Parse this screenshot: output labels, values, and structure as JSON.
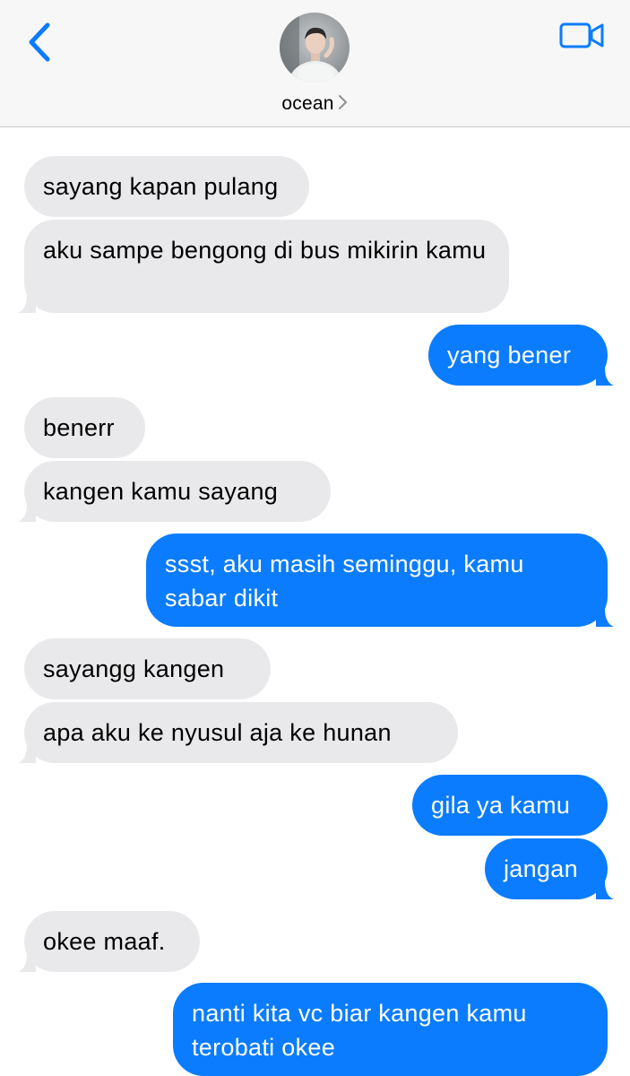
{
  "header": {
    "contact_name": "ocean"
  },
  "messages": [
    {
      "side": "in",
      "text": "sayang kapan pulang"
    },
    {
      "side": "in",
      "text": "aku sampe bengong di bus mikirin kamu"
    },
    {
      "side": "out",
      "text": "yang bener"
    },
    {
      "side": "in",
      "text": "benerr"
    },
    {
      "side": "in",
      "text": "kangen kamu sayang"
    },
    {
      "side": "out",
      "text": "ssst, aku masih seminggu, kamu sabar dikit"
    },
    {
      "side": "in",
      "text": "sayangg kangen"
    },
    {
      "side": "in",
      "text": "apa aku ke nyusul aja ke hunan"
    },
    {
      "side": "out",
      "text": "gila ya kamu"
    },
    {
      "side": "out",
      "text": "jangan"
    },
    {
      "side": "in",
      "text": "okee maaf."
    },
    {
      "side": "out",
      "text": "nanti kita vc biar kangen kamu terobati okee"
    }
  ],
  "colors": {
    "accent": "#0b7cfe",
    "incoming_bubble": "#e9e9eb",
    "header_bg": "#f7f7f7"
  },
  "icons": {
    "back": "chevron-left-icon",
    "video": "video-camera-icon",
    "contact_chevron": "chevron-right-icon"
  }
}
